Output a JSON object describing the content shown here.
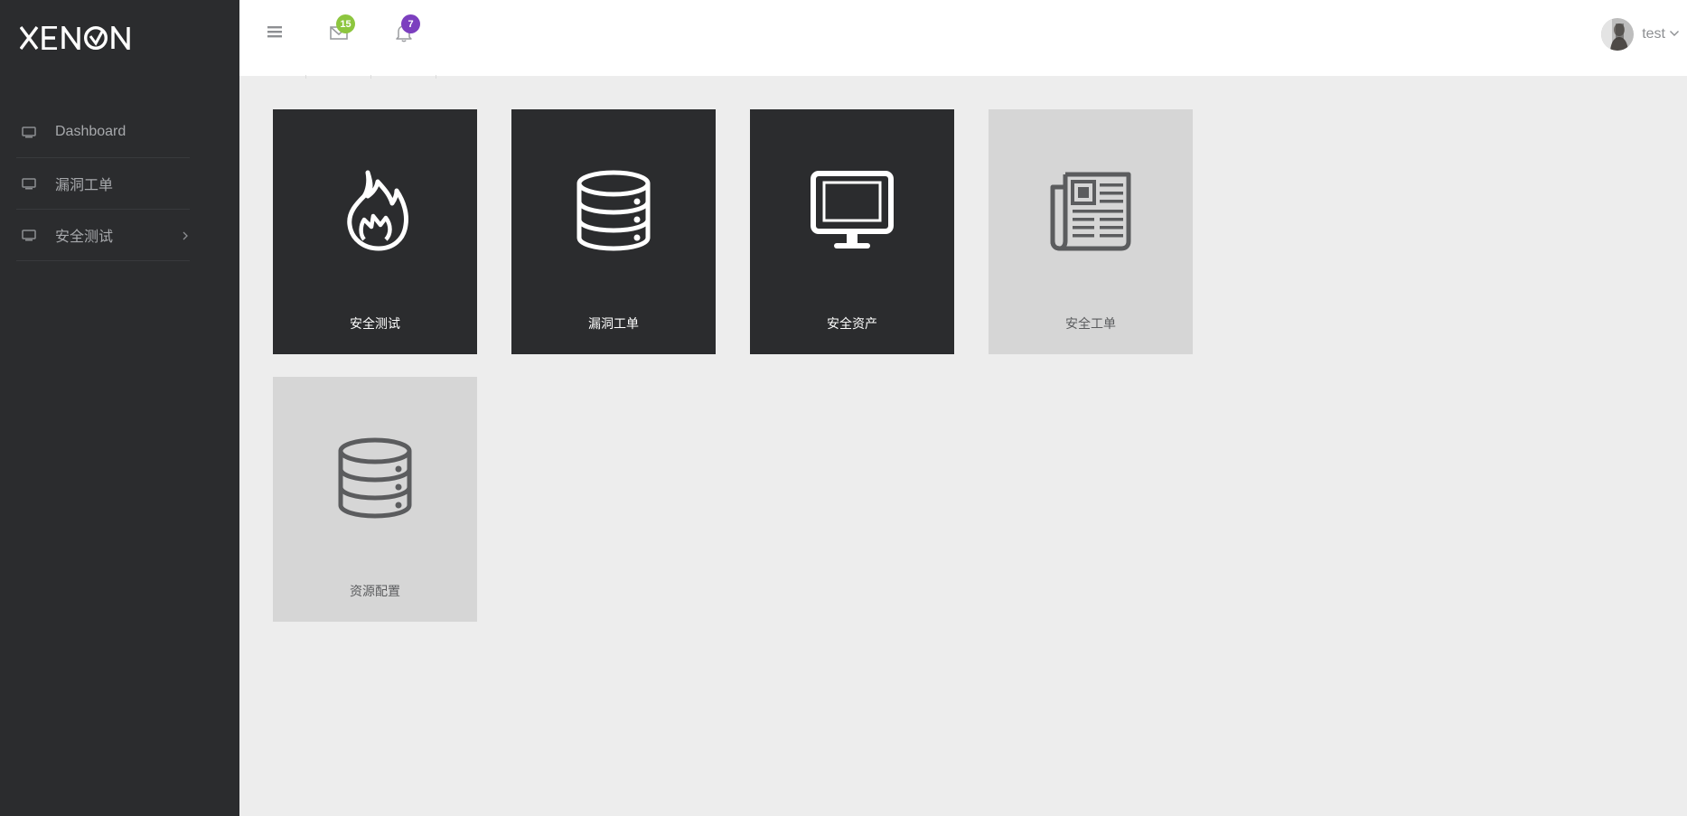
{
  "brand": {
    "name": "XENON"
  },
  "sidebar": {
    "items": [
      {
        "label": "Dashboard",
        "icon": "monitor-icon"
      },
      {
        "label": "漏洞工单",
        "icon": "monitor-icon"
      },
      {
        "label": "安全测试",
        "icon": "monitor-icon",
        "has_submenu": true
      }
    ]
  },
  "topbar": {
    "menu_icon": "hamburger-icon",
    "mail": {
      "icon": "mail-icon",
      "count": "15",
      "badge_color": "#8dc63f"
    },
    "notifications": {
      "icon": "bell-icon",
      "count": "7",
      "badge_color": "#7c3fbf"
    },
    "user": {
      "name": "test",
      "icon": "chevron-down-icon"
    }
  },
  "tiles": [
    {
      "label": "安全测试",
      "icon": "fire-icon",
      "style": "dark"
    },
    {
      "label": "漏洞工单",
      "icon": "database-icon",
      "style": "dark"
    },
    {
      "label": "安全资产",
      "icon": "desktop-icon",
      "style": "dark"
    },
    {
      "label": "安全工单",
      "icon": "newspaper-icon",
      "style": "light"
    },
    {
      "label": "资源配置",
      "icon": "database-icon",
      "style": "light"
    }
  ],
  "colors": {
    "sidebar_bg": "#2b2c2e",
    "content_bg": "#ededed",
    "tile_dark": "#2b2c2e",
    "tile_light": "#d6d6d6"
  }
}
